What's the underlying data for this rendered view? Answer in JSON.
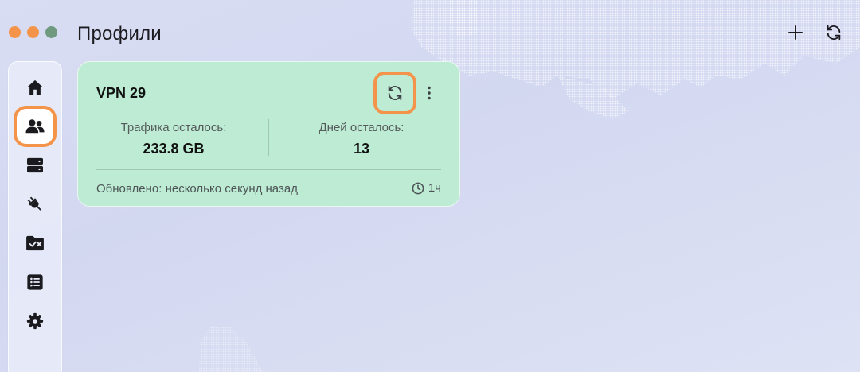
{
  "window": {
    "title": "Профили"
  },
  "top_actions": {
    "add_icon": "plus-icon",
    "refresh_icon": "refresh-icon"
  },
  "sidebar": {
    "items": [
      {
        "id": "home",
        "icon": "home-icon",
        "active": false
      },
      {
        "id": "profiles",
        "icon": "users-icon",
        "active": true
      },
      {
        "id": "servers",
        "icon": "server-icon",
        "active": false
      },
      {
        "id": "connections",
        "icon": "plug-icon",
        "active": false
      },
      {
        "id": "rules",
        "icon": "folder-check-icon",
        "active": false
      },
      {
        "id": "logs",
        "icon": "list-icon",
        "active": false
      },
      {
        "id": "settings",
        "icon": "gear-icon",
        "active": false
      }
    ]
  },
  "profile_card": {
    "name": "VPN 29",
    "traffic_label": "Трафика осталось:",
    "traffic_value": "233.8 GB",
    "days_label": "Дней осталось:",
    "days_value": "13",
    "updated_text": "Обновлено: несколько секунд назад",
    "age": "1ч"
  },
  "colors": {
    "accent": "#f4944a",
    "card_bg": "#bdebd4",
    "background": "#d8dcf2"
  }
}
